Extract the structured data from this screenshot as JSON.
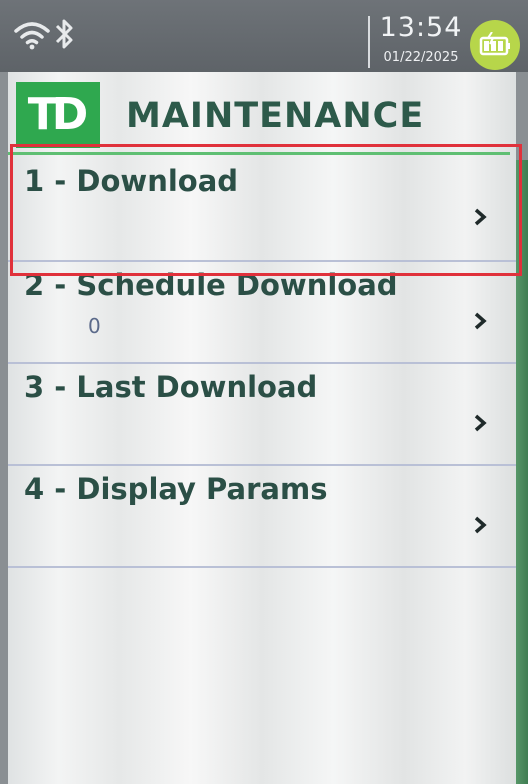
{
  "status_bar": {
    "time": "13:54",
    "date": "01/22/2025",
    "icons": [
      "wifi-icon",
      "bluetooth-icon",
      "battery-charging-icon"
    ]
  },
  "header": {
    "logo_text": "TD",
    "title": "MAINTENANCE"
  },
  "menu": {
    "items": [
      {
        "label": "1 - Download",
        "sub": ""
      },
      {
        "label": "2 - Schedule Download",
        "sub": "0"
      },
      {
        "label": "3 - Last Download",
        "sub": ""
      },
      {
        "label": "4 - Display Params",
        "sub": ""
      }
    ]
  },
  "colors": {
    "accent_green": "#2fa84f",
    "title_text": "#2d5a4a",
    "highlight_box": "#e0313b",
    "battery_badge": "#b7d64a"
  }
}
